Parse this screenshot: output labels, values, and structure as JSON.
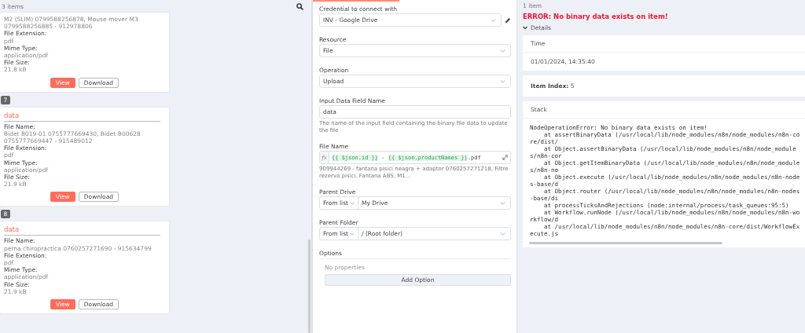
{
  "input_panel": {
    "count": "3 items",
    "cards": [
      {
        "lines": [
          {
            "kind": "value",
            "text": "M2 (SLIM) 0799588256878, Mouse mover M3 0799588256885 - 912978806"
          },
          {
            "kind": "label",
            "text": "File Extension:"
          },
          {
            "kind": "value",
            "text": "pdf"
          },
          {
            "kind": "label",
            "text": "Mime Type:"
          },
          {
            "kind": "value",
            "text": "application/pdf"
          },
          {
            "kind": "label",
            "text": "File Size:"
          },
          {
            "kind": "value",
            "text": "21.8 kB"
          }
        ],
        "buttons": [
          {
            "label": "View",
            "kind": "primary"
          },
          {
            "label": "Download",
            "kind": "secondary"
          }
        ]
      },
      {
        "index": "7",
        "title": "data",
        "lines": [
          {
            "kind": "label",
            "text": "File Name:"
          },
          {
            "kind": "value",
            "text": "Bidet B019-01 0755777669430, Bidet B00628 0755777669447 - 915489012"
          },
          {
            "kind": "label",
            "text": "File Extension:"
          },
          {
            "kind": "value",
            "text": "pdf"
          },
          {
            "kind": "label",
            "text": "Mime Type:"
          },
          {
            "kind": "value",
            "text": "application/pdf"
          },
          {
            "kind": "label",
            "text": "File Size:"
          },
          {
            "kind": "value",
            "text": "21.9 kB"
          }
        ],
        "buttons": [
          {
            "label": "View",
            "kind": "primary"
          },
          {
            "label": "Download",
            "kind": "secondary"
          }
        ]
      },
      {
        "index": "8",
        "title": "data",
        "lines": [
          {
            "kind": "label",
            "text": "File Name:"
          },
          {
            "kind": "value",
            "text": "perna chiropractica 0760257271690 - 915634799"
          },
          {
            "kind": "label",
            "text": "File Extension:"
          },
          {
            "kind": "value",
            "text": "pdf"
          },
          {
            "kind": "label",
            "text": "Mime Type:"
          },
          {
            "kind": "value",
            "text": "application/pdf"
          },
          {
            "kind": "label",
            "text": "File Size:"
          },
          {
            "kind": "value",
            "text": "21.9 kB"
          }
        ],
        "buttons": [
          {
            "label": "View",
            "kind": "primary"
          },
          {
            "label": "Download",
            "kind": "secondary"
          }
        ]
      }
    ]
  },
  "parameters": {
    "fields": [
      {
        "kind": "select",
        "label": "Credential to connect with",
        "value": "INV - Google Drive",
        "editable": true
      },
      {
        "kind": "select",
        "label": "Resource",
        "value": "File"
      },
      {
        "kind": "select",
        "label": "Operation",
        "value": "Upload"
      },
      {
        "kind": "input",
        "label": "Input Data Field Name",
        "value": "data",
        "hint": "The name of the input field containing the binary file data to update the file"
      },
      {
        "kind": "expression",
        "label": "File Name",
        "prefix": "fx",
        "parts": [
          {
            "kind": "expr",
            "text": "{{ $json.id }}"
          },
          {
            "kind": "plain",
            "text": " - "
          },
          {
            "kind": "expr",
            "text": "{{ $json.productNames }}"
          },
          {
            "kind": "plain",
            "text": ".pdf"
          }
        ],
        "hint": "909944269 - fantana pisici neagra + adaptor 0760257271218, Filtre rezerva pisici, Fantana ABS, M1..."
      },
      {
        "kind": "locator",
        "label": "Parent Drive",
        "mode": "From list",
        "value": "My Drive"
      },
      {
        "kind": "locator",
        "label": "Parent Folder",
        "mode": "From list",
        "value": "/ (Root folder)"
      }
    ],
    "options": {
      "label": "Options",
      "empty": "No properties",
      "button": "Add Option"
    }
  },
  "output_panel": {
    "count": "1 item",
    "error": "ERROR: No binary data exists on item!",
    "details": {
      "label": "Details",
      "expanded": true
    },
    "time": {
      "label": "Time",
      "value": "01/01/2024, 14:35:40"
    },
    "item_index": {
      "label": "Item Index:",
      "value": "5"
    },
    "stack": {
      "label": "Stack",
      "lines": [
        "NodeOperationError: No binary data exists on item!",
        "    at assertBinaryData (/usr/local/lib/node_modules/n8n/node_modules/n8n-core/dist/",
        "    at Object.assertBinaryData (/usr/local/lib/node_modules/n8n/node_modules/n8n-cor",
        "    at Object.getItemBinaryData (/usr/local/lib/node_modules/n8n/node_modules/n8n-no",
        "    at Object.execute (/usr/local/lib/node_modules/n8n/node_modules/n8n-nodes-base/d",
        "    at Object.router (/usr/local/lib/node_modules/n8n/node_modules/n8n-nodes-base/di",
        "    at processTicksAndRejections (node:internal/process/task_queues:95:5)",
        "    at Workflow.runNode (/usr/local/lib/node_modules/n8n/node_modules/n8n-workflow/d",
        "    at /usr/local/lib/node_modules/n8n/node_modules/n8n-core/dist/WorkflowExecute.js"
      ]
    }
  }
}
